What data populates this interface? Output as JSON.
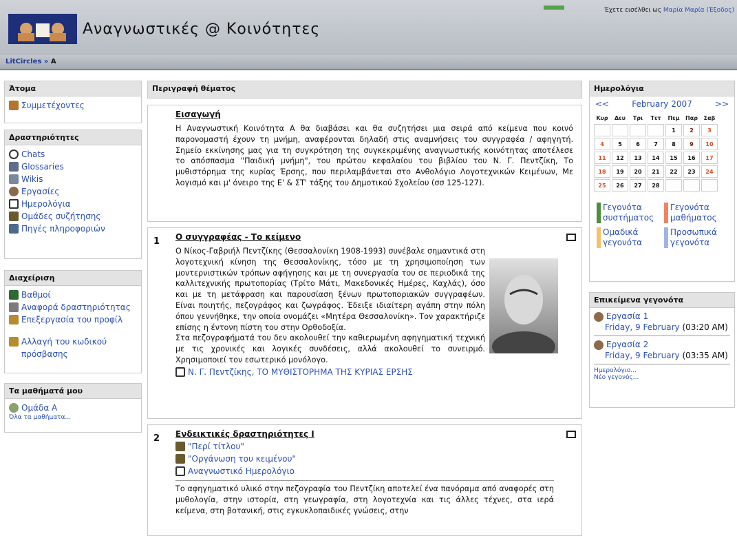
{
  "header": {
    "site_title": "Αναγνωστικές @ Κοινότητες",
    "login_prefix": "Έχετε εισέλθει ως",
    "login_user": "Μαρία Μαρία",
    "logout": "(Έξοδος)"
  },
  "breadcrumb": {
    "root": "LitCircles",
    "sep": "»",
    "current": "A"
  },
  "left": {
    "people": {
      "title": "Άτομα",
      "items": [
        {
          "label": "Συμμετέχοντες",
          "icon": "people-icon"
        }
      ]
    },
    "activities": {
      "title": "Δραστηριότητες",
      "items": [
        {
          "label": "Chats",
          "icon": "chat-icon"
        },
        {
          "label": "Glossaries",
          "icon": "glossary-icon"
        },
        {
          "label": "Wikis",
          "icon": "wiki-icon"
        },
        {
          "label": "Εργασίες",
          "icon": "assignment-icon"
        },
        {
          "label": "Ημερολόγια",
          "icon": "journal-icon"
        },
        {
          "label": "Ομάδες συζήτησης",
          "icon": "forum-icon"
        },
        {
          "label": "Πηγές πληροφοριών",
          "icon": "resource-icon"
        }
      ]
    },
    "admin": {
      "title": "Διαχείριση",
      "items": [
        {
          "label": "Βαθμοί",
          "icon": "grades-icon"
        },
        {
          "label": "Αναφορά δραστηριότητας",
          "icon": "report-icon"
        },
        {
          "label": "Επεξεργασία του προφίλ",
          "icon": "profile-icon"
        },
        {
          "label": "Αλλαγή του κωδικού πρόσβασης",
          "icon": "password-icon"
        }
      ]
    },
    "courses": {
      "title": "Τα μαθήματά μου",
      "items": [
        {
          "label": "Ομάδα A",
          "icon": "course-icon"
        }
      ],
      "all": "Όλα τα μαθήματα..."
    }
  },
  "main": {
    "title": "Περιγραφή θέματος",
    "intro": {
      "title": "Εισαγωγή",
      "text": "Η Αναγνωστική Κοινότητα A θα διαβάσει και θα συζητήσει μια σειρά από κείμενα που κοινό παρονομαστή έχουν τη μνήμη, αναφέρονται δηλαδή στις αναμνήσεις του συγγραφέα / αφηγητή. Σημείο εκκίνησης μας για τη συγκρότηση της συγκεκριμένης αναγνωστικής κοινότητας αποτέλεσε το απόσπασμα \"Παιδική μνήμη\", του πρώτου κεφαλαίου του βιβλίου του Ν. Γ. Πεντζίκη, Το μυθιστόρημα της κυρίας Έρσης, που περιλαμβάνεται στο Ανθολόγιο Λογοτεχνικών Κειμένων, Με λογισμό και μ' όνειρο της Ε' & ΣΤ' τάξης του Δημοτικού Σχολείου (σσ 125-127)."
    },
    "topic1": {
      "num": "1",
      "title": "Ο συγγραφέας - Το κείμενο",
      "text": "Ο Νίκος-Γαβριήλ Πεντζίκης (Θεσσαλονίκη 1908-1993) συνέβαλε σημαντικά στη λογοτεχνική κίνηση της Θεσσαλονίκης, τόσο με τη χρησιμοποίηση των μοντερνιστικών τρόπων αφήγησης και με τη συνεργασία του σε περιοδικά της καλλιτεχνικής πρωτοπορίας (Τρίτο Μάτι, Μακεδονικές Ημέρες, Καχλάς), όσο και με τη μετάφραση και παρουσίαση ξένων πρωτοποριακών συγγραφέων. Είναι ποιητής, πεζογράφος και ζωγράφος. Έδειξε ιδιαίτερη αγάπη στην πόλη όπου γεννήθηκε, την οποία ονομάζει «Μητέρα Θεσσαλονίκη». Τον χαρακτήριζε επίσης η έντονη πίστη του στην Ορθοδοξία.",
      "text2": "Στα πεζογραφήματά του δεν ακολουθεί την καθιερωμένη αφηγηματική τεχνική με τις χρονικές και λογικές συνδέσεις, αλλά ακολουθεί το συνειρμό. Χρησιμοποιεί τον εσωτερικό μονόλογο.",
      "resource": "Ν. Γ. Πεντζίκης, ΤΟ ΜΥΘΙΣΤΟΡΗΜΑ ΤΗΣ ΚΥΡΙΑΣ ΕΡΣΗΣ"
    },
    "topic2": {
      "num": "2",
      "title": "Ενδεικτικές δραστηριότητες Ι",
      "acts": [
        {
          "label": "\"Περί τίτλου\"",
          "icon": "forum-icon"
        },
        {
          "label": "\"Οργάνωση του κειμένου\"",
          "icon": "forum-icon"
        },
        {
          "label": "Αναγνωστικό Ημερολόγιο",
          "icon": "journal-icon"
        }
      ],
      "text": "Το αφηγηματικό υλικό στην πεζογραφία του Πεντζίκη αποτελεί ένα πανόραμα από αναφορές στη μυθολογία, στην ιστορία, στη γεωγραφία, στη λογοτεχνία και τις άλλες τέχνες, στα ιερά κείμενα, στη βοτανική, στις εγκυκλοπαιδικές γνώσεις, στην"
    }
  },
  "calendar": {
    "title": "Ημερολόγια",
    "prev": "<<",
    "next": ">>",
    "month": "February 2007",
    "days": [
      "Κυρ",
      "Δευ",
      "Τρι",
      "Τετ",
      "Πεμ",
      "Παρ",
      "Σαβ"
    ],
    "weeks": [
      [
        "",
        "",
        "",
        "",
        "1",
        "2",
        "3"
      ],
      [
        "4",
        "5",
        "6",
        "7",
        "8",
        "9",
        "10"
      ],
      [
        "11",
        "12",
        "13",
        "14",
        "15",
        "16",
        "17"
      ],
      [
        "18",
        "19",
        "20",
        "21",
        "22",
        "23",
        "24"
      ],
      [
        "25",
        "26",
        "27",
        "28",
        "",
        "",
        ""
      ]
    ],
    "today": "7",
    "event_days": [
      "2",
      "9"
    ],
    "legend": [
      {
        "label": "Γεγονότα συστήματος",
        "color": "#4a8f3a"
      },
      {
        "label": "Γεγονότα μαθήματος",
        "color": "#f08461"
      },
      {
        "label": "Ομαδικά γεγονότα",
        "color": "#f3c26b"
      },
      {
        "label": "Προσωπικά γεγονότα",
        "color": "#9fb7e0"
      }
    ]
  },
  "upcoming": {
    "title": "Επικείμενα γεγονότα",
    "events": [
      {
        "name": "Εργασία 1",
        "date": "Friday, 9 February",
        "time": "(03:20 AM)"
      },
      {
        "name": "Εργασία 2",
        "date": "Friday, 9 February",
        "time": "(03:35 AM)"
      }
    ],
    "calendar_link": "Ημερολόγιο...",
    "new_event": "Νέο γεγονός..."
  }
}
